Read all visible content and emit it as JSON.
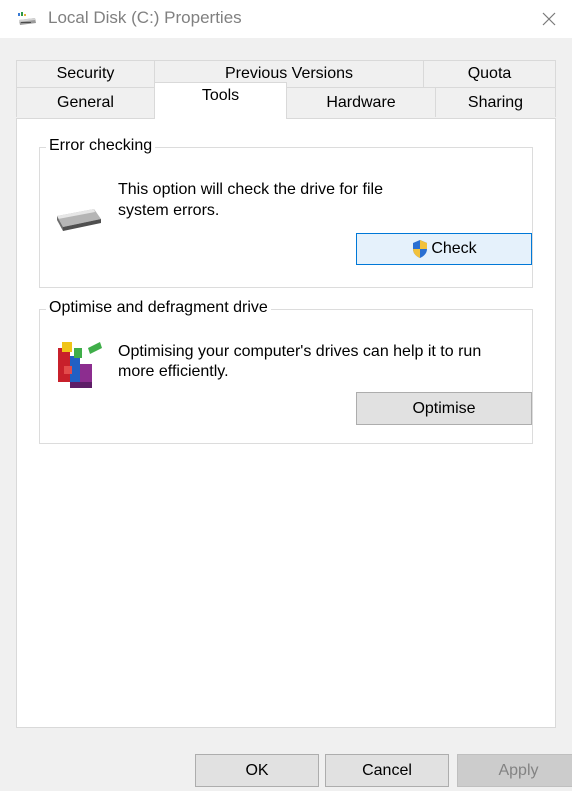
{
  "window": {
    "title": "Local Disk (C:) Properties",
    "title_icon": "drive-icon",
    "close_icon": "close-icon"
  },
  "tabs": {
    "row1": [
      {
        "label": "Security"
      },
      {
        "label": "Previous Versions"
      },
      {
        "label": "Quota"
      }
    ],
    "row2": [
      {
        "label": "General"
      },
      {
        "label": "Tools",
        "active": true
      },
      {
        "label": "Hardware"
      },
      {
        "label": "Sharing"
      }
    ]
  },
  "error_checking": {
    "heading": "Error checking",
    "line1": "This option will check the drive for file",
    "line2": "system errors.",
    "button_label": "Check",
    "icon": "hard-drive-icon",
    "button_icon": "uac-shield-icon"
  },
  "optimise": {
    "heading": "Optimise and defragment drive",
    "line1": "Optimising your computer's drives can help it to run",
    "line2": "more efficiently.",
    "button_label": "Optimise",
    "icon": "defrag-icon"
  },
  "footer": {
    "ok_label": "OK",
    "cancel_label": "Cancel",
    "apply_label": "Apply"
  },
  "colors": {
    "accent": "#0078d7",
    "dialog_background": "#f0f0f0",
    "panel_background": "#ffffff"
  }
}
